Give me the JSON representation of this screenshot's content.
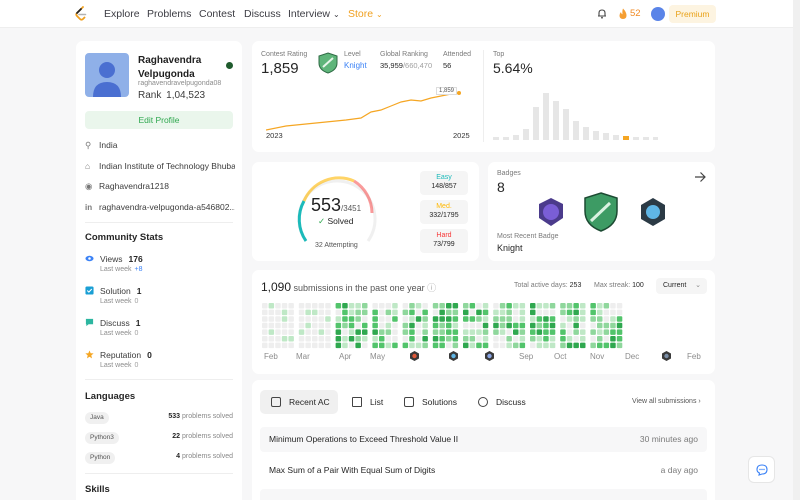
{
  "nav": {
    "links": [
      "Explore",
      "Problems",
      "Contest",
      "Discuss",
      "Interview",
      "Store"
    ],
    "streak": "52",
    "premium": "Premium"
  },
  "profile": {
    "name": "Raghavendra Velpugonda",
    "username": "raghavendravelpugonda08",
    "rank_label": "Rank",
    "rank_value": "1,04,523",
    "edit_label": "Edit Profile",
    "location": "India",
    "institute": "Indian Institute of Technology Bhubaneswar",
    "github": "Raghavendra1218",
    "linkedin": "raghavendra-velpugonda-a546802..."
  },
  "community": {
    "title": "Community Stats",
    "items": [
      {
        "label": "Views",
        "value": "176",
        "week": "Last week",
        "delta": "+8",
        "color": "#3b82f6"
      },
      {
        "label": "Solution",
        "value": "1",
        "week": "Last week",
        "delta": "0",
        "color": "#1a9fd4"
      },
      {
        "label": "Discuss",
        "value": "1",
        "week": "Last week",
        "delta": "0",
        "color": "#2cb6a0"
      },
      {
        "label": "Reputation",
        "value": "0",
        "week": "Last week",
        "delta": "0",
        "color": "#f5a623"
      }
    ]
  },
  "languages": {
    "title": "Languages",
    "items": [
      {
        "name": "Java",
        "count": "533",
        "suffix": "problems solved"
      },
      {
        "name": "Python3",
        "count": "22",
        "suffix": "problems solved"
      },
      {
        "name": "Python",
        "count": "4",
        "suffix": "problems solved"
      }
    ]
  },
  "skills": {
    "title": "Skills"
  },
  "contest": {
    "rating_label": "Contest Rating",
    "rating": "1,859",
    "level_label": "Level",
    "level": "Knight",
    "global_label": "Global Ranking",
    "global_rank": "35,959",
    "global_total": "/660,470",
    "attended_label": "Attended",
    "attended": "56",
    "top_label": "Top",
    "top": "5.64%",
    "chart_peak_label": "1,859",
    "year_start": "2023",
    "year_end": "2025"
  },
  "solved": {
    "solved": "553",
    "total": "/3451",
    "solved_label": "Solved",
    "attempting": "32 Attempting",
    "easy_label": "Easy",
    "easy": "148/857",
    "med_label": "Med.",
    "med": "332/1795",
    "hard_label": "Hard",
    "hard": "73/799"
  },
  "badges": {
    "label": "Badges",
    "count": "8",
    "recent_label": "Most Recent Badge",
    "recent": "Knight"
  },
  "submissions": {
    "count": "1,090",
    "text": "submissions in the past one year",
    "active_label": "Total active days:",
    "active": "253",
    "streak_label": "Max streak:",
    "streak": "100",
    "dropdown": "Current",
    "months": [
      "Feb",
      "Mar",
      "Apr",
      "May",
      "Sep",
      "Oct",
      "Nov",
      "Dec",
      "Feb"
    ]
  },
  "recent": {
    "tabs": [
      "Recent AC",
      "List",
      "Solutions",
      "Discuss"
    ],
    "view_all": "View all submissions",
    "rows": [
      {
        "title": "Minimum Operations to Exceed Threshold Value II",
        "time": "30 minutes ago"
      },
      {
        "title": "Max Sum of a Pair With Equal Sum of Digits",
        "time": "a day ago"
      }
    ]
  },
  "colors": {
    "accent_green": "#2fa84f",
    "easy": "#1cbaba",
    "medium": "#ffb800",
    "hard": "#f63737",
    "premium": "#e9a219"
  }
}
